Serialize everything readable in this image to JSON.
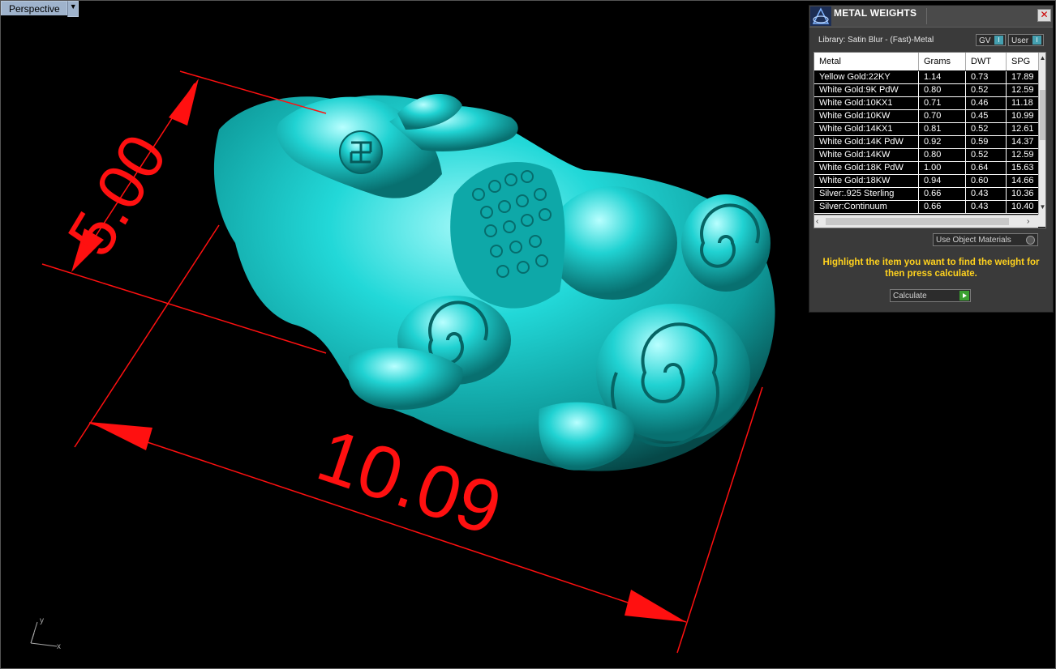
{
  "viewport": {
    "title": "Perspective",
    "dimensions": {
      "height": "5.00",
      "length": "10.09"
    }
  },
  "axis": {
    "x": "x",
    "y": "y"
  },
  "panel": {
    "title": "METAL WEIGHTS",
    "library_label": "Library: Satin Blur - (Fast)-Metal",
    "gv_toggle": "GV",
    "user_toggle": "User",
    "columns": [
      "Metal",
      "Grams",
      "DWT",
      "SPG"
    ],
    "rows": [
      [
        "Yellow Gold:22KY",
        "1.14",
        "0.73",
        "17.89"
      ],
      [
        "White Gold:9K PdW",
        "0.80",
        "0.52",
        "12.59"
      ],
      [
        "White Gold:10KX1",
        "0.71",
        "0.46",
        "11.18"
      ],
      [
        "White Gold:10KW",
        "0.70",
        "0.45",
        "10.99"
      ],
      [
        "White Gold:14KX1",
        "0.81",
        "0.52",
        "12.61"
      ],
      [
        "White Gold:14K PdW",
        "0.92",
        "0.59",
        "14.37"
      ],
      [
        "White Gold:14KW",
        "0.80",
        "0.52",
        "12.59"
      ],
      [
        "White Gold:18K PdW",
        "1.00",
        "0.64",
        "15.63"
      ],
      [
        "White Gold:18KW",
        "0.94",
        "0.60",
        "14.66"
      ],
      [
        "Silver:.925 Sterling",
        "0.66",
        "0.43",
        "10.36"
      ],
      [
        "Silver:Continuum",
        "0.66",
        "0.43",
        "10.40"
      ]
    ],
    "use_object_materials": "Use Object Materials",
    "hint": "Highlight the item you want to find the weight for then press calculate.",
    "calculate_label": "Calculate"
  },
  "colors": {
    "model": "#1fd6d6",
    "dimension": "#ff1010",
    "hint": "#ffd21e",
    "viewport_bg": "#000000",
    "panel_bg": "#3a3a3a"
  }
}
